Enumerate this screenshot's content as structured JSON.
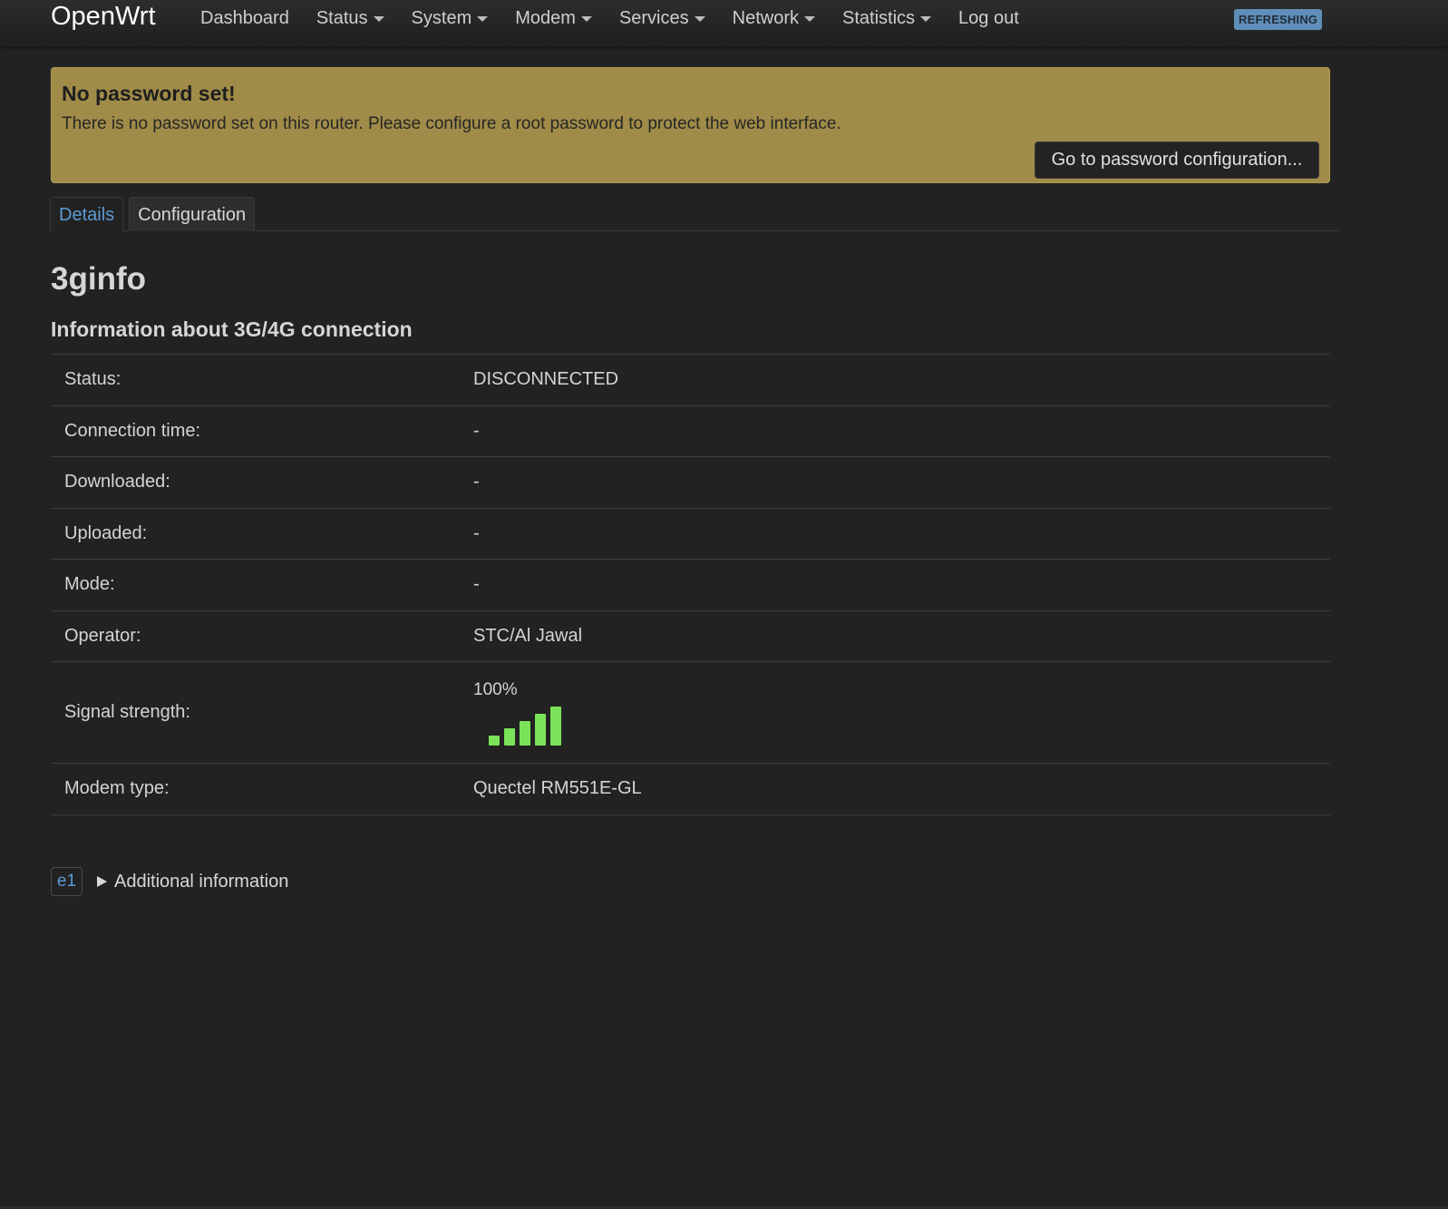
{
  "header": {
    "brand": "OpenWrt",
    "nav": [
      {
        "label": "Dashboard",
        "dropdown": false
      },
      {
        "label": "Status",
        "dropdown": true
      },
      {
        "label": "System",
        "dropdown": true
      },
      {
        "label": "Modem",
        "dropdown": true
      },
      {
        "label": "Services",
        "dropdown": true
      },
      {
        "label": "Network",
        "dropdown": true
      },
      {
        "label": "Statistics",
        "dropdown": true
      },
      {
        "label": "Log out",
        "dropdown": false
      }
    ],
    "badge": "REFRESHING"
  },
  "alert": {
    "title": "No password set!",
    "text": "There is no password set on this router. Please configure a root password to protect the web interface.",
    "button": "Go to password configuration..."
  },
  "tabs": [
    {
      "label": "Details",
      "active": true
    },
    {
      "label": "Configuration",
      "active": false
    }
  ],
  "page": {
    "title": "3ginfo",
    "subtitle": "Information about 3G/4G connection"
  },
  "info": {
    "status": {
      "label": "Status:",
      "value": "DISCONNECTED"
    },
    "connection_time": {
      "label": "Connection time:",
      "value": "-"
    },
    "downloaded": {
      "label": "Downloaded:",
      "value": "-"
    },
    "uploaded": {
      "label": "Uploaded:",
      "value": "-"
    },
    "mode": {
      "label": "Mode:",
      "value": "-"
    },
    "operator": {
      "label": "Operator:",
      "value": "STC/Al Jawal"
    },
    "signal": {
      "label": "Signal strength:",
      "value": "100%",
      "bars_total": 5,
      "bars_lit": 5
    },
    "modem_type": {
      "label": "Modem type:",
      "value": "Quectel RM551E-GL"
    }
  },
  "additional": {
    "badge": "e1",
    "label": "Additional information"
  },
  "colors": {
    "background": "#222222",
    "alert": "#a08c48",
    "accent": "#5d9bd3",
    "signal": "#7be35a"
  }
}
